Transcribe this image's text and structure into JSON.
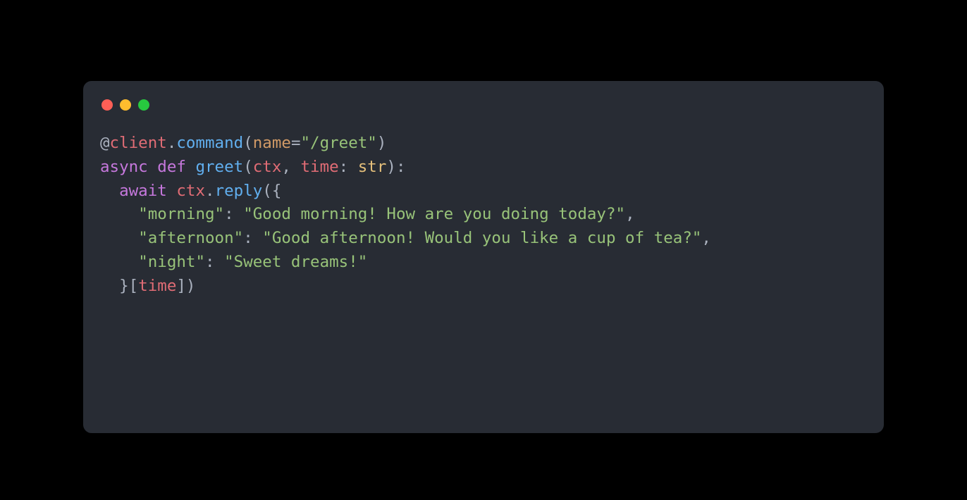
{
  "colors": {
    "background": "#000000",
    "window": "#282c34",
    "traffic_red": "#ff5f56",
    "traffic_yellow": "#ffbd2e",
    "traffic_green": "#27c93f",
    "text_default": "#abb2bf",
    "keyword": "#c678dd",
    "variable": "#e06c75",
    "function": "#61afef",
    "param": "#d19a66",
    "type": "#e5c07b",
    "string": "#98c379"
  },
  "code": {
    "at": "@",
    "client": "client",
    "dot": ".",
    "command": "command",
    "lparen": "(",
    "name_kw": "name",
    "eq": "=",
    "cmd_str": "\"/greet\"",
    "rparen": ")",
    "async": "async",
    "space": " ",
    "def": "def",
    "greet": "greet",
    "ctx": "ctx",
    "comma_sp": ", ",
    "time": "time",
    "colon_sp": ": ",
    "str_type": "str",
    "colon": ":",
    "indent1": "  ",
    "indent2": "    ",
    "await": "await",
    "reply": "reply",
    "lbrace": "{",
    "k_morning": "\"morning\"",
    "v_morning": "\"Good morning! How are you doing today?\"",
    "comma": ",",
    "k_afternoon": "\"afternoon\"",
    "v_afternoon": "\"Good afternoon! Would you like a cup of tea?\"",
    "k_night": "\"night\"",
    "v_night": "\"Sweet dreams!\"",
    "rbrace": "}",
    "lbrack": "[",
    "rbrack": "]"
  }
}
